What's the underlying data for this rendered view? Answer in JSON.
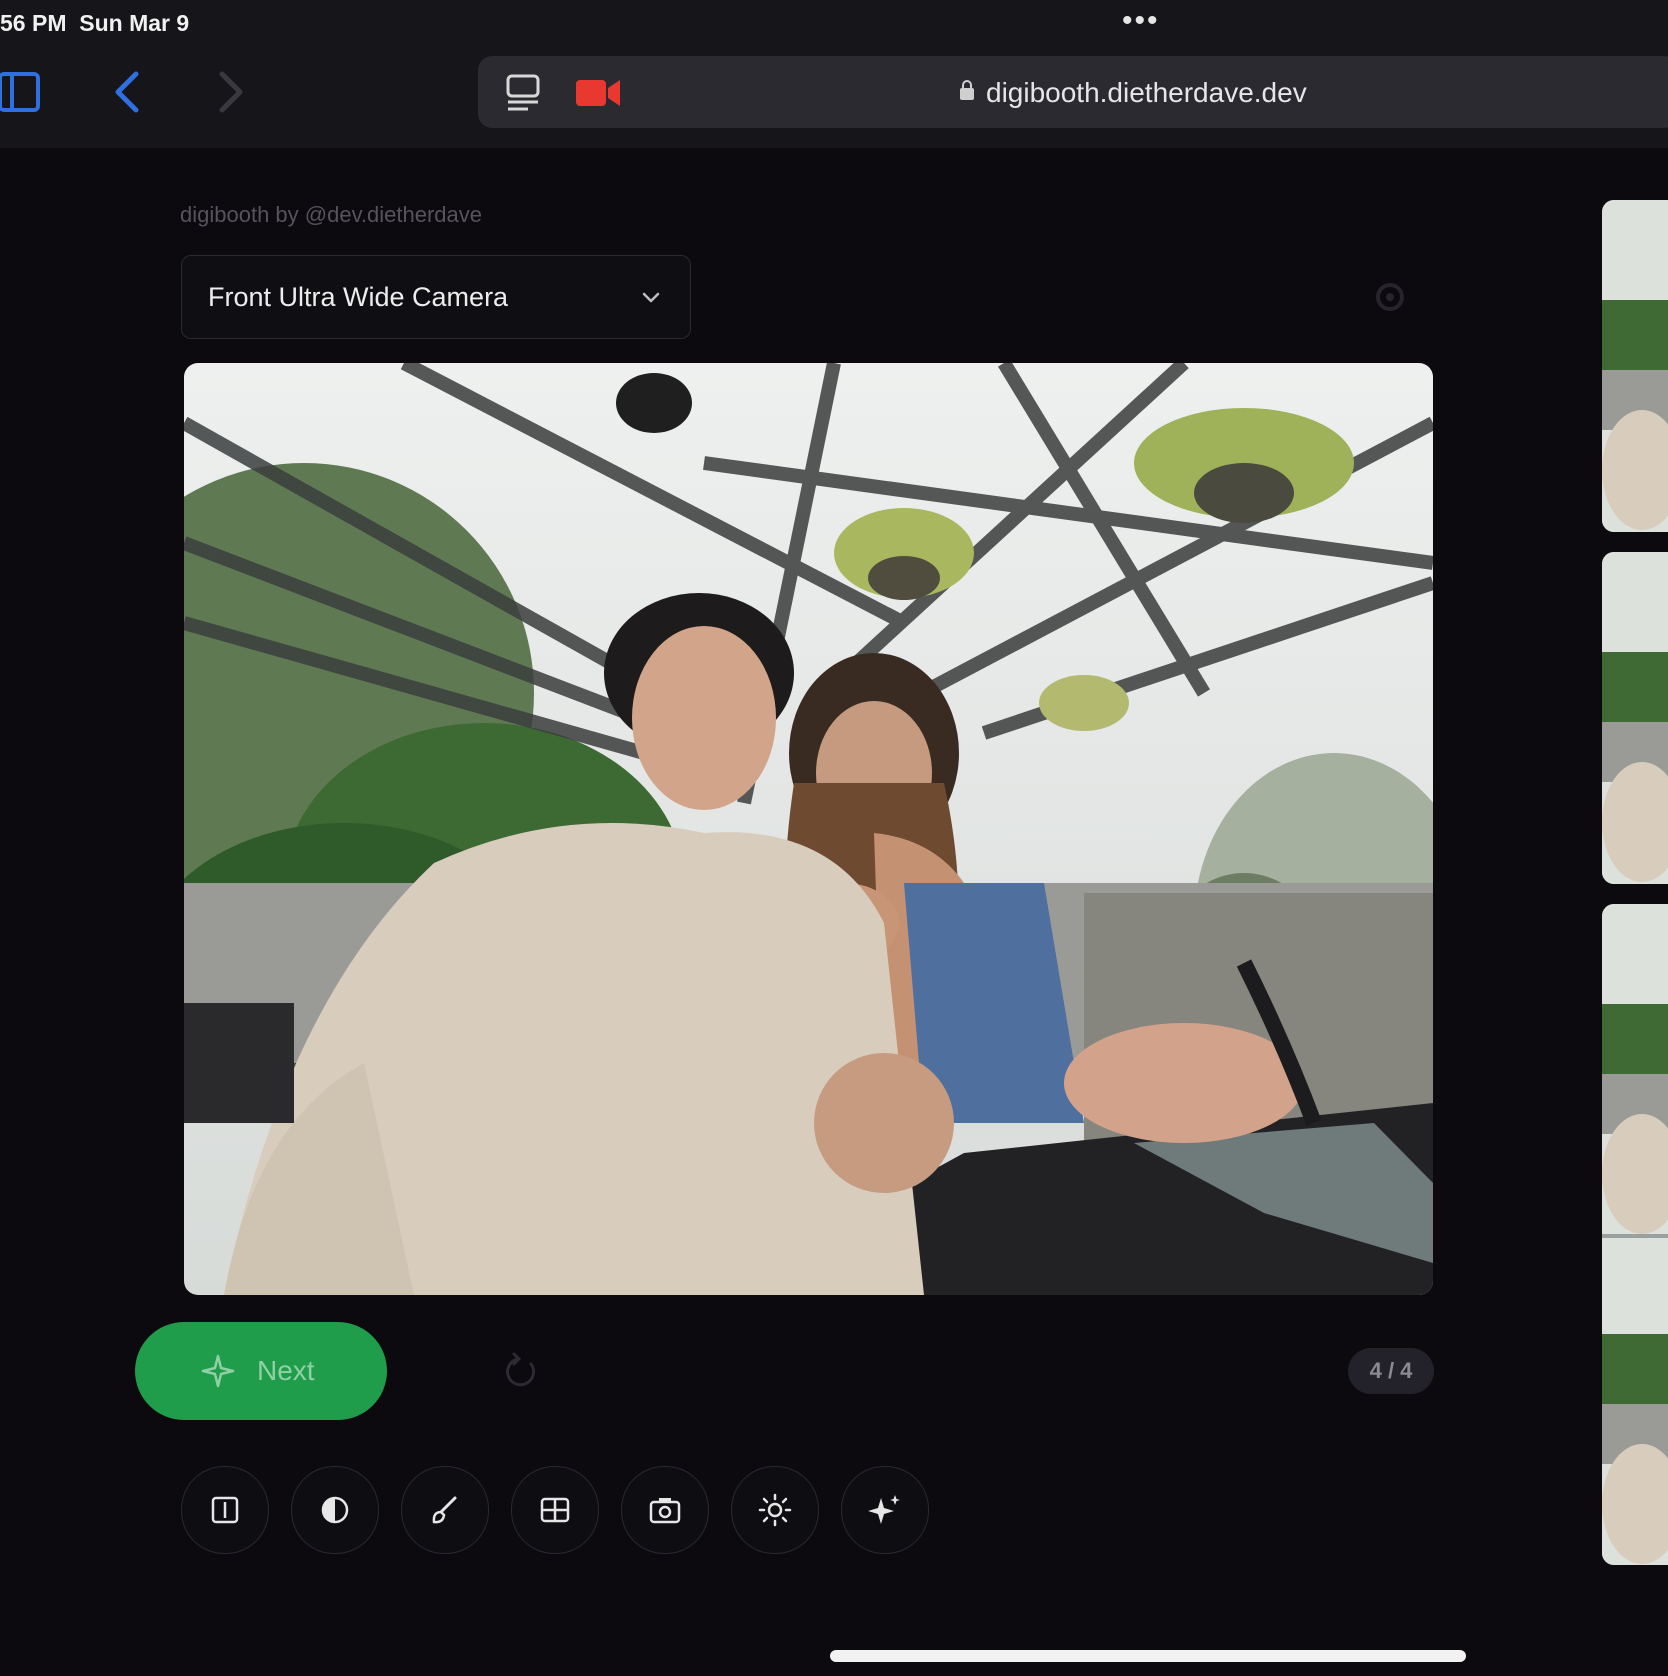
{
  "status": {
    "time": "56 PM",
    "date": "Sun Mar 9"
  },
  "browser": {
    "url": "digibooth.dietherdave.dev",
    "icons": [
      "sidebar-icon",
      "back-chevron-icon",
      "forward-chevron-icon",
      "reader-icon",
      "camera-recording-icon",
      "lock-icon"
    ]
  },
  "app": {
    "brand": "digibooth by @dev.dietherdave",
    "camera_select": {
      "selected": "Front Ultra Wide Camera"
    },
    "next_button": {
      "label": "Next"
    },
    "counter": "4 / 4",
    "tools": [
      "frame-icon",
      "filter-icon",
      "brush-icon",
      "layout-icon",
      "camera-icon",
      "brightness-icon",
      "sparkle-icon"
    ]
  },
  "colors": {
    "accent": "#1f9d4b",
    "recording": "#e8382f",
    "link_blue": "#2f6fe0",
    "background": "#0c0a0f"
  }
}
